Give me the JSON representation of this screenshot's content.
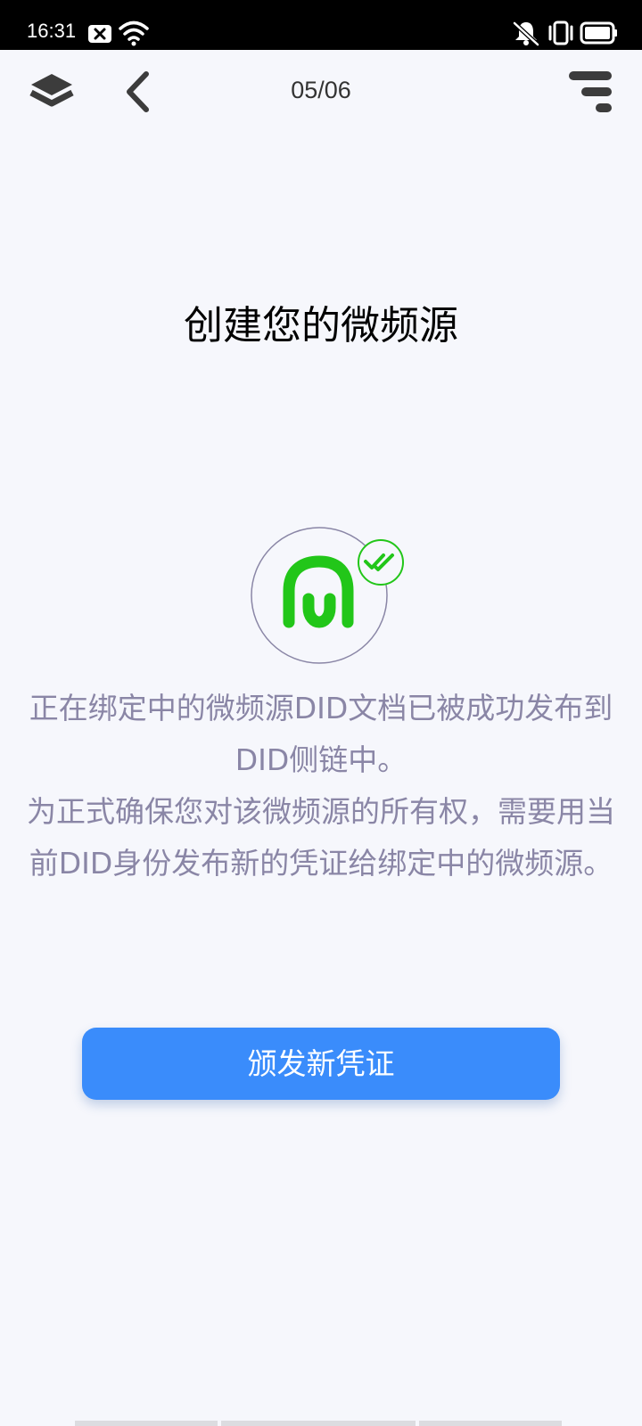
{
  "status_bar": {
    "time": "16:31",
    "icons": [
      "notification-x-icon",
      "wifi-icon",
      "mute-icon",
      "vibrate-icon",
      "battery-icon"
    ]
  },
  "nav": {
    "page_counter": "05/06",
    "left_icons": [
      "layers-icon",
      "back-chevron-icon"
    ],
    "right_icon": "menu-icon"
  },
  "main": {
    "title": "创建您的微频源",
    "logo": {
      "icon": "feeds-logo-icon",
      "badge_icon": "double-check-icon",
      "logo_color": "#22c619",
      "ring_color": "#8a86a6"
    },
    "description_lines": [
      "正在绑定中的微频源DID文档已被成功发布到",
      "DID侧链中。",
      "为正式确保您对该微频源的所有权，需要用当",
      "前DID身份发布新的凭证给绑定中的微频源。"
    ],
    "primary_button": "颁发新凭证"
  },
  "colors": {
    "background": "#f6f7fc",
    "accent": "#3a8cfb",
    "description_text": "#8a86a6"
  }
}
